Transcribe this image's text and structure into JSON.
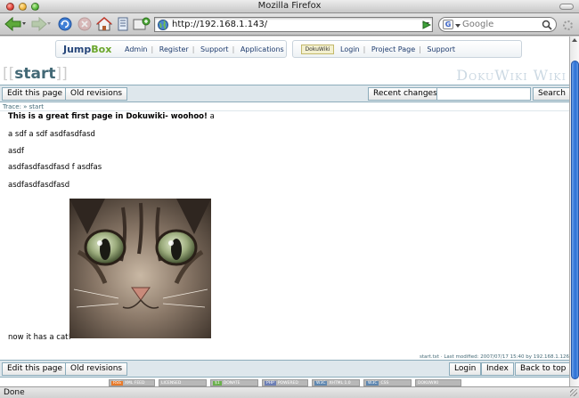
{
  "window": {
    "title": "Mozilla Firefox"
  },
  "toolbar": {
    "url": "http://192.168.1.143/",
    "search_placeholder": "Google",
    "search_engine_badge": "G"
  },
  "jumpbox": {
    "logo_jump": "Jump",
    "logo_box": "Box",
    "links": [
      "Admin",
      "Register",
      "Support",
      "Applications"
    ]
  },
  "dokuwiki_bar": {
    "logo": "DokuWiki",
    "links": [
      "Login",
      "Project Page",
      "Support"
    ]
  },
  "page": {
    "title_open": "[[",
    "title_name": "start",
    "title_close": "]]",
    "wiki_title": "DokuWiki Wiki",
    "trace": "Trace: » start",
    "content": {
      "p1_bold": "This is a great first page in Dokuwiki- woohoo!",
      "p1_rest": " a",
      "p2": "a sdf a sdf asdfasdfasd",
      "p3": "asdf",
      "p4": "asdfasdfasdfasd f asdfas",
      "p5": "asdfasdfasdfasd",
      "p6": "now it has a cat!"
    },
    "last_modified": "start.txt · Last modified: 2007/07/17 15:40 by 192.168.1.126"
  },
  "buttons_top": {
    "edit": "Edit this page",
    "revisions": "Old revisions",
    "recent": "Recent changes",
    "search": "Search"
  },
  "buttons_bottom": {
    "edit": "Edit this page",
    "revisions": "Old revisions",
    "login": "Login",
    "index": "Index",
    "top": "Back to top"
  },
  "footer_badges": [
    {
      "key": "RSS",
      "label": "XML FEED"
    },
    {
      "key": "",
      "label": "LICENSED"
    },
    {
      "key": "$1",
      "label": "DONATE"
    },
    {
      "key": "PHP",
      "label": "POWERED"
    },
    {
      "key": "W3C",
      "label": "XHTML 1.0"
    },
    {
      "key": "W3C",
      "label": "CSS"
    },
    {
      "key": "",
      "label": "DOKUWIKI"
    }
  ],
  "status": {
    "text": "Done"
  },
  "colors": {
    "accent": "#436976",
    "bar_bg": "#dee7ec",
    "bar_border": "#8cacbb",
    "scroll_thumb": "#2a6fd6"
  }
}
